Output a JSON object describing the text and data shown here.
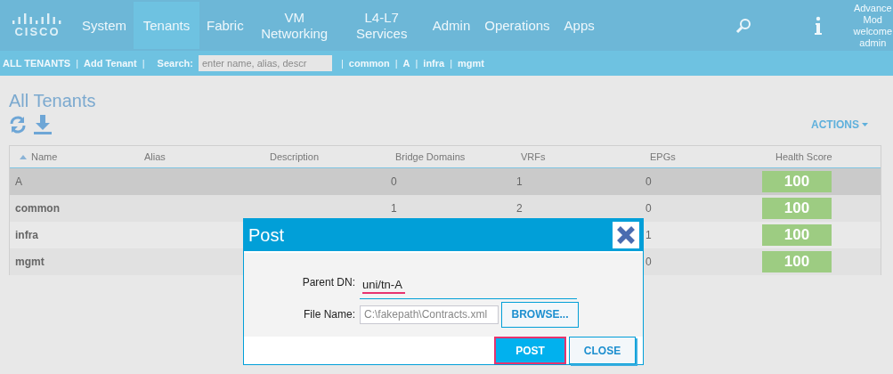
{
  "nav": {
    "logo": "CISCO",
    "items": [
      {
        "label": "System",
        "selected": false
      },
      {
        "label": "Tenants",
        "selected": true
      },
      {
        "label": "Fabric",
        "selected": false
      },
      {
        "label": "VM Networking",
        "selected": false
      },
      {
        "label": "L4-L7 Services",
        "selected": false
      },
      {
        "label": "Admin",
        "selected": false
      },
      {
        "label": "Operations",
        "selected": false
      },
      {
        "label": "Apps",
        "selected": false
      }
    ],
    "user_lines": [
      "Advance",
      "Mod",
      "welcome",
      "admin"
    ]
  },
  "subnav": {
    "separator": "|",
    "all": "ALL TENANTS",
    "add": "Add Tenant",
    "search_label": "Search:",
    "search_placeholder": "enter name, alias, descr",
    "quick_links": [
      "common",
      "A",
      "infra",
      "mgmt"
    ]
  },
  "page": {
    "title": "All Tenants",
    "actions": "ACTIONS"
  },
  "table": {
    "columns": [
      "Name",
      "Alias",
      "Description",
      "Bridge Domains",
      "VRFs",
      "EPGs",
      "Health Score"
    ],
    "rows": [
      {
        "name": "A",
        "bridge_domains": "0",
        "vrfs": "1",
        "epgs": "0",
        "health": "100",
        "selected": true
      },
      {
        "name": "common",
        "bridge_domains": "1",
        "vrfs": "2",
        "epgs": "0",
        "health": "100",
        "selected": false
      },
      {
        "name": "infra",
        "epgs": "1",
        "health": "100",
        "selected": false
      },
      {
        "name": "mgmt",
        "epgs": "0",
        "health": "100",
        "selected": false
      }
    ]
  },
  "dialog": {
    "title": "Post",
    "parent_dn_label": "Parent DN:",
    "parent_dn_value": "uni/tn-A",
    "file_label": "File Name:",
    "file_value": "C:\\fakepath\\Contracts.xml",
    "browse": "BROWSE...",
    "post": "POST",
    "close": "CLOSE"
  }
}
